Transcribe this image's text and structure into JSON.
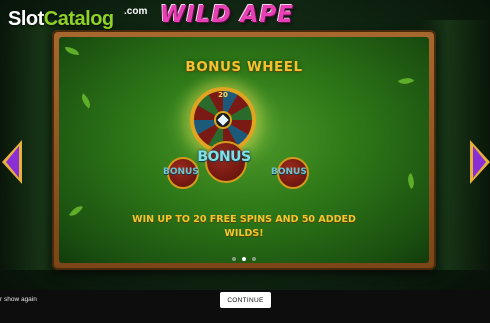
{
  "branding": {
    "site_name_part1": "Slot",
    "site_name_part2": "Catalog",
    "site_tld": ".com",
    "game_title": "WILD APE"
  },
  "info_panel": {
    "title": "BONUS WHEEL",
    "description": "WIN UP TO 20 FREE SPINS AND 50 ADDED WILDS!",
    "wheel_top_value": "20",
    "bonus_symbol_text": "BONUS",
    "bonus_side_left": "BONUS",
    "bonus_side_right": "BONUS",
    "page_count": 3,
    "active_page_index": 1
  },
  "navigation": {
    "prev_icon": "chevron-left-icon",
    "next_icon": "chevron-right-icon",
    "arrow_color": "#8a2fd6"
  },
  "footer": {
    "dont_show_label": "r show again",
    "continue_label": "CONTINUE"
  },
  "colors": {
    "title_gold": "#f2c230",
    "frame_wood": "#a8682e",
    "panel_green": "#2f7a18",
    "brand_green": "#8fd128"
  }
}
